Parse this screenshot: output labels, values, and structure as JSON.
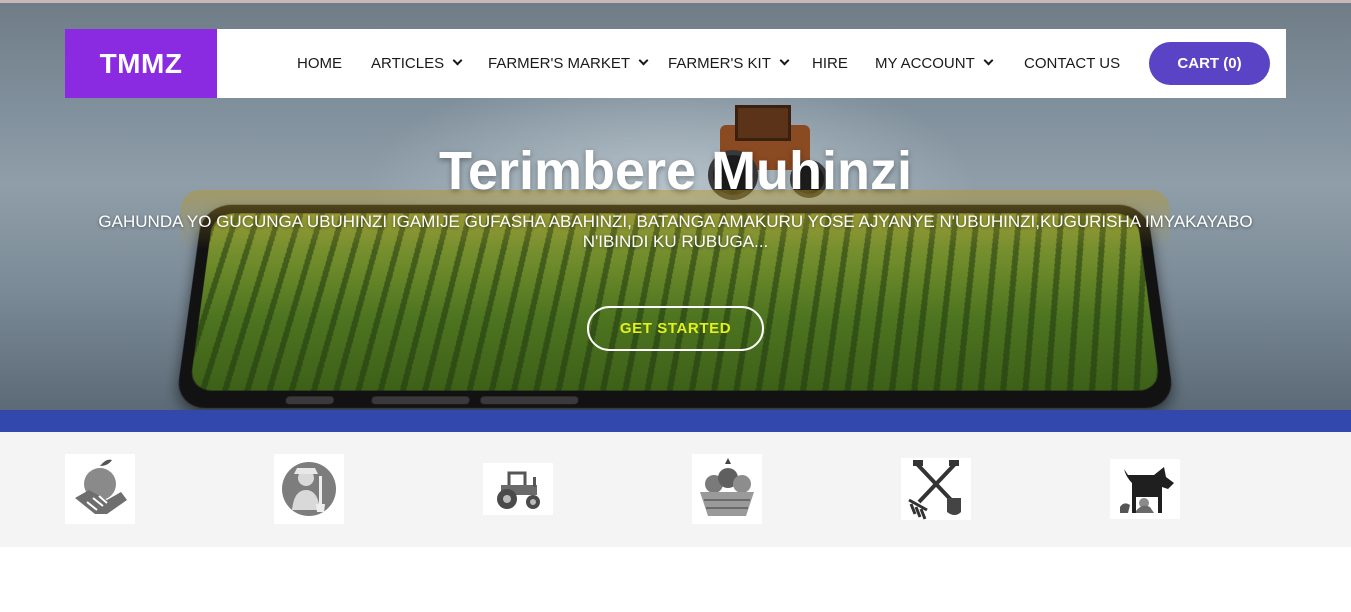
{
  "brand": {
    "logo_text": "TMMZ",
    "accent": "#8a2be2"
  },
  "nav": {
    "items": [
      {
        "label": "HOME",
        "has_dropdown": false
      },
      {
        "label": "ARTICLES",
        "has_dropdown": true
      },
      {
        "label": "FARMER'S MARKET",
        "has_dropdown": true
      },
      {
        "label": "FARMER'S KIT",
        "has_dropdown": true
      },
      {
        "label": "HIRE",
        "has_dropdown": false
      },
      {
        "label": "MY ACCOUNT",
        "has_dropdown": true
      },
      {
        "label": "CONTACT US",
        "has_dropdown": false
      }
    ],
    "cart_label": "CART (0)",
    "cart_color": "#5b43c6"
  },
  "hero": {
    "title": "Terimbere Muhinzi",
    "subtitle": "GAHUNDA YO GUCUNGA UBUHINZI IGAMIJE GUFASHA ABAHINZI, BATANGA AMAKURU YOSE AJYANYE N'UBUHINZI,KUGURISHA IMYAKAYABO N'IBINDI KU RUBUGA...",
    "cta_label": "GET STARTED",
    "cta_color": "#e3f01a"
  },
  "strip_color": "#3348ad",
  "categories": [
    {
      "icon": "handshake-apple-icon"
    },
    {
      "icon": "farmer-icon"
    },
    {
      "icon": "tractor-icon"
    },
    {
      "icon": "produce-basket-icon"
    },
    {
      "icon": "farm-tools-icon"
    },
    {
      "icon": "livestock-icon"
    }
  ]
}
